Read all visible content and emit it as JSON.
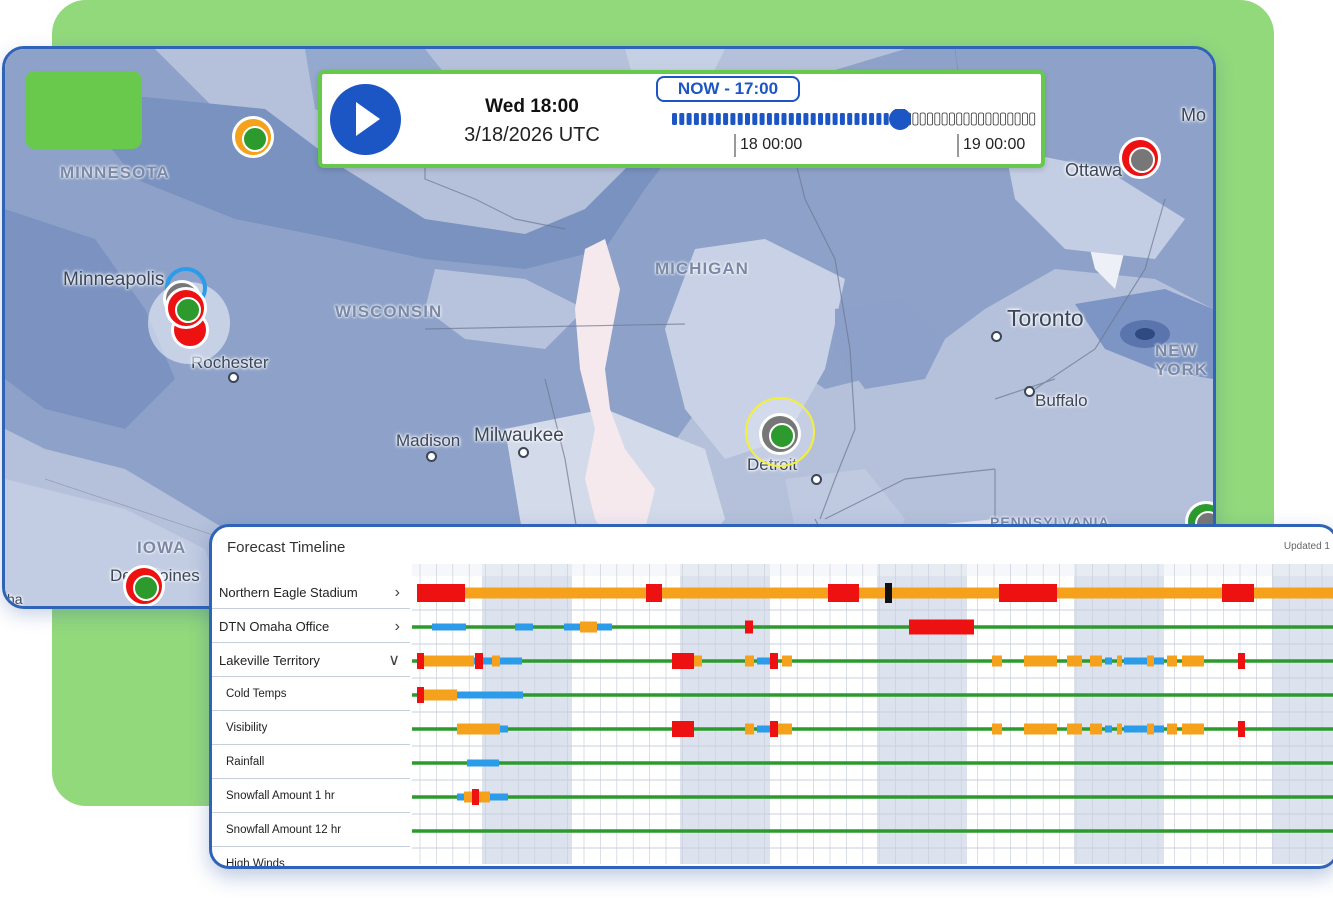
{
  "map": {
    "labels": {
      "minnesota": "MINNESOTA",
      "wisconsin": "WISCONSIN",
      "michigan": "MICHIGAN",
      "iowa": "IOWA",
      "new_york": "NEW YORK",
      "pennsylvania": "PENNSYLVANIA"
    },
    "cities": {
      "minneapolis": "Minneapolis",
      "rochester": "Rochester",
      "madison": "Madison",
      "milwaukee": "Milwaukee",
      "detroit": "Detroit",
      "toronto": "Toronto",
      "buffalo": "Buffalo",
      "ottawa": "Ottawa",
      "des_moines": "Des Moines",
      "montreal_partial": "Mo",
      "omaha_partial": "ha"
    }
  },
  "playback": {
    "day_time": "Wed 18:00",
    "date": "3/18/2026 UTC",
    "now_label": "NOW - 17:00",
    "tick1": "18 00:00",
    "tick2": "19 00:00",
    "progress": 0.63
  },
  "timeline": {
    "title": "Forecast Timeline",
    "updated": "Updated 1",
    "rows": [
      {
        "label": "Northern Eagle Stadium",
        "chevron": ">",
        "sub": false
      },
      {
        "label": "DTN Omaha Office",
        "chevron": ">",
        "sub": false
      },
      {
        "label": "Lakeville Territory",
        "chevron": "v",
        "sub": false
      },
      {
        "label": "Cold Temps",
        "chevron": "",
        "sub": true
      },
      {
        "label": "Visibility",
        "chevron": "",
        "sub": true
      },
      {
        "label": "Rainfall",
        "chevron": "",
        "sub": true
      },
      {
        "label": "Snowfall Amount 1 hr",
        "chevron": "",
        "sub": true
      },
      {
        "label": "Snowfall Amount 12 hr",
        "chevron": "",
        "sub": true
      },
      {
        "label": "High Winds",
        "chevron": "",
        "sub": true
      }
    ],
    "colors": {
      "ok": "#2c9a2c",
      "moderate": "#f5a11c",
      "severe": "#ee1111",
      "snow": "#2b9bea",
      "marker": "#111111"
    }
  }
}
